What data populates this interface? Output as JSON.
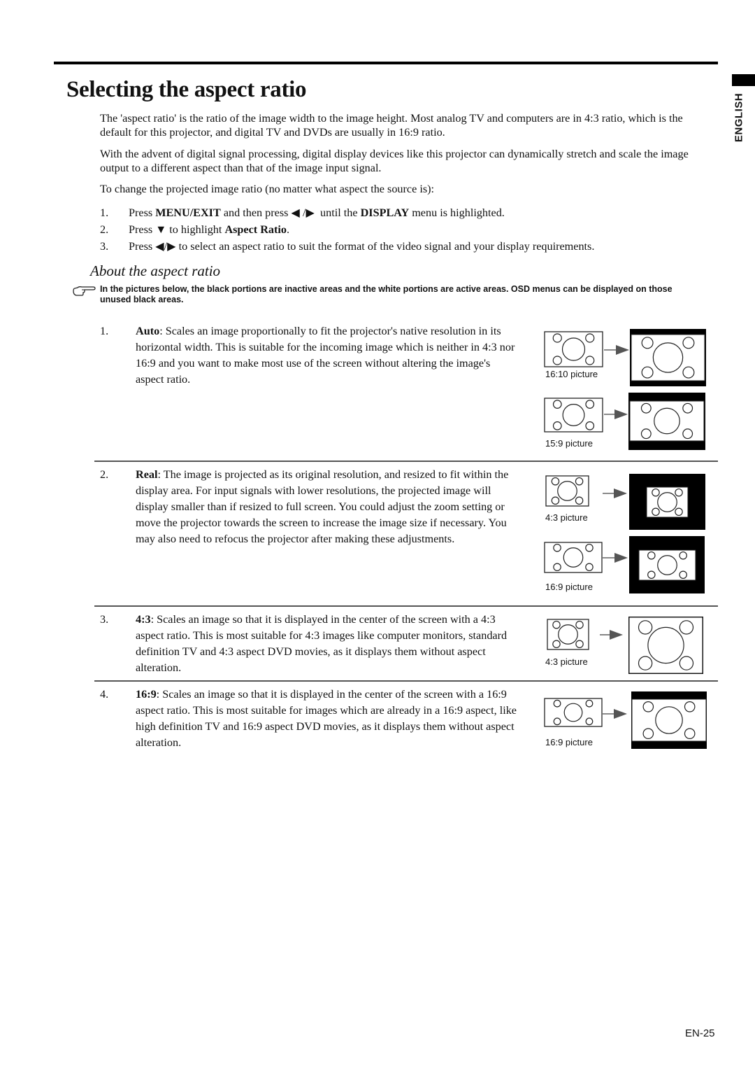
{
  "header": {
    "language_tab": "ENGLISH"
  },
  "page_title": "Selecting the aspect ratio",
  "intro": {
    "p1": "The 'aspect ratio' is the ratio of the image width to the image height. Most analog TV and computers are in 4:3 ratio, which is the default for this projector, and digital TV and DVDs are usually in 16:9 ratio.",
    "p2": "With the advent of digital signal processing, digital display devices like this projector can dynamically stretch and scale the image output to a different aspect than that of the image input signal.",
    "p3": "To change the projected image ratio (no matter what aspect the source is):"
  },
  "steps": [
    {
      "num": "1.",
      "pre": "Press ",
      "b1": "MENU/EXIT",
      "mid": " and then press ◀ /▶  until the ",
      "b2": "DISPLAY",
      "post": " menu is highlighted."
    },
    {
      "num": "2.",
      "pre": "Press ▼ to highlight ",
      "b1": "Aspect Ratio",
      "post": "."
    },
    {
      "num": "3.",
      "pre": "Press ◀/▶ to select an aspect ratio to suit the format of the video signal and your display requirements."
    }
  ],
  "subsection_title": "About the aspect ratio",
  "note": {
    "icon": "pointing-hand-icon",
    "text": "In the pictures below, the black portions are inactive areas and the white portions are active areas. OSD menus can be displayed on those unused black areas."
  },
  "modes": [
    {
      "num": "1.",
      "name": "Auto",
      "desc": ": Scales an image proportionally to fit the projector's native resolution in its horizontal width. This is suitable for the incoming image which is neither in 4:3 nor 16:9 and you want to make most use of the screen without altering the image's aspect ratio.",
      "examples": [
        {
          "caption": "16:10 picture"
        },
        {
          "caption": "15:9 picture"
        }
      ]
    },
    {
      "num": "2.",
      "name": "Real",
      "desc": ": The image is projected as its original resolution, and resized to fit within the display area. For input signals with lower resolutions, the projected image will display smaller than if resized to full screen. You could adjust the zoom setting or move the projector towards the screen to increase the image size if necessary. You may also need to refocus the projector after making these adjustments.",
      "examples": [
        {
          "caption": "4:3 picture"
        },
        {
          "caption": "16:9 picture"
        }
      ]
    },
    {
      "num": "3.",
      "name": "4:3",
      "desc": ": Scales an image so that it is displayed in the center of the screen with a 4:3 aspect ratio. This is most suitable for 4:3 images like computer monitors, standard definition TV and 4:3 aspect DVD movies, as it displays them without aspect alteration.",
      "examples": [
        {
          "caption": "4:3 picture"
        }
      ]
    },
    {
      "num": "4.",
      "name": "16:9",
      "desc": ": Scales an image so that it is displayed in the center of the screen with a 16:9 aspect ratio. This is most suitable for images which are already in a 16:9 aspect, like high definition TV and 16:9 aspect DVD movies, as it displays them without aspect alteration.",
      "examples": [
        {
          "caption": "16:9 picture"
        }
      ]
    }
  ],
  "footer": {
    "page_number": "EN-25"
  }
}
